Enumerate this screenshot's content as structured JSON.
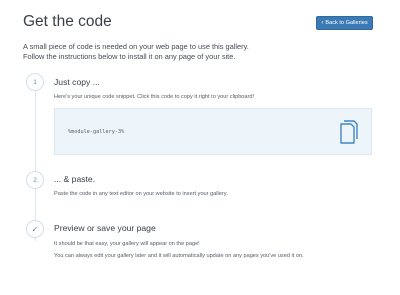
{
  "header": {
    "title": "Get the code",
    "back_button": "Back to Galleries"
  },
  "intro": {
    "line1": "A small piece of code is needed on your web page to use this gallery.",
    "line2": "Follow the instructions below to install it on any page of your site."
  },
  "steps": [
    {
      "marker": "1",
      "title": "Just copy ...",
      "text": "Here's your unique code snippet. Click this code to copy it right to your clipboard!",
      "code": "%module-gallery-3%"
    },
    {
      "marker": "2",
      "title": "... & paste.",
      "text": "Paste the code in any text editor on your website to insert your gallery."
    },
    {
      "marker": "✓",
      "title": "Preview or save your page",
      "text": "It should be that easy, your gallery will appear on the page!",
      "text2": "You can always edit your gallery later and it will automatically update on any pages you've used it on."
    }
  ],
  "icons": {
    "copy": "copy-icon",
    "back": "chevron-left-icon"
  },
  "colors": {
    "accent": "#3b7ab5",
    "code_bg": "#eef5fa",
    "timeline": "#dde8f0"
  }
}
